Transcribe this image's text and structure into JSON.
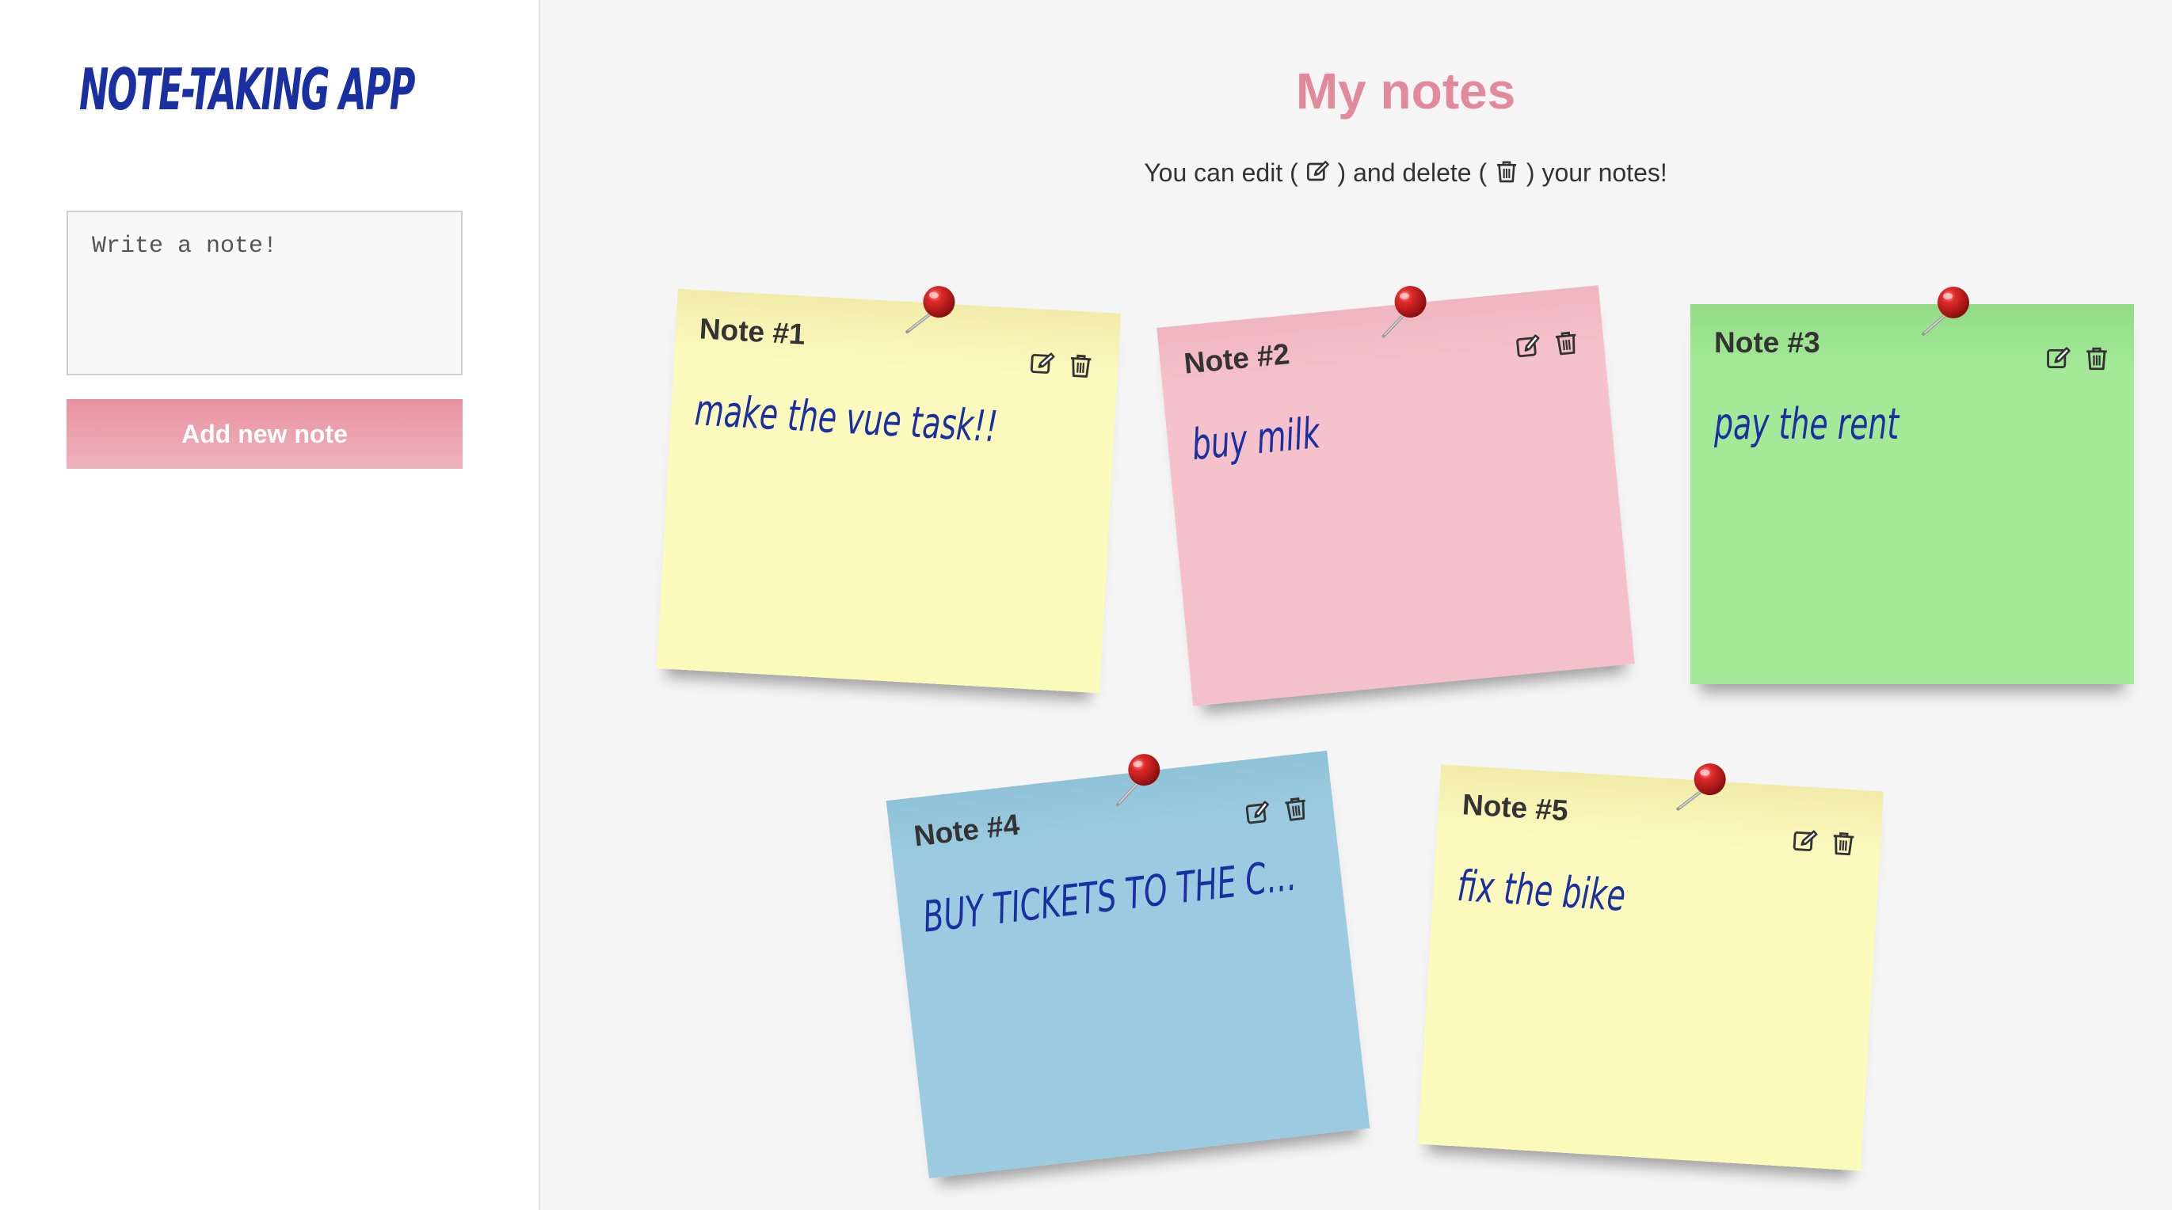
{
  "sidebar": {
    "app_title": "NOTE-TAKING APP",
    "note_input_placeholder": "Write a note!",
    "add_button_label": "Add new note"
  },
  "main": {
    "title": "My notes",
    "subtitle_part1": "You can edit (",
    "subtitle_part2": ") and delete (",
    "subtitle_part3": ") your notes!"
  },
  "notes": [
    {
      "title": "Note #1",
      "text": "make the vue task!!",
      "color": "#fcfabb"
    },
    {
      "title": "Note #2",
      "text": "buy milk",
      "color": "#f4c0ca"
    },
    {
      "title": "Note #3",
      "text": "pay the rent",
      "color": "#a3e997"
    },
    {
      "title": "Note #4",
      "text": "BUY TICKETS TO THE CO...",
      "color": "#9ccbe1"
    },
    {
      "title": "Note #5",
      "text": "fix the bike",
      "color": "#fcfabb"
    }
  ],
  "icons": {
    "edit": "edit-icon",
    "delete": "trash-icon",
    "pin": "pushpin-icon"
  },
  "colors": {
    "title_blue": "#1a2fa0",
    "heading_pink": "#e08a9b",
    "button_pink": "#e7939f"
  }
}
